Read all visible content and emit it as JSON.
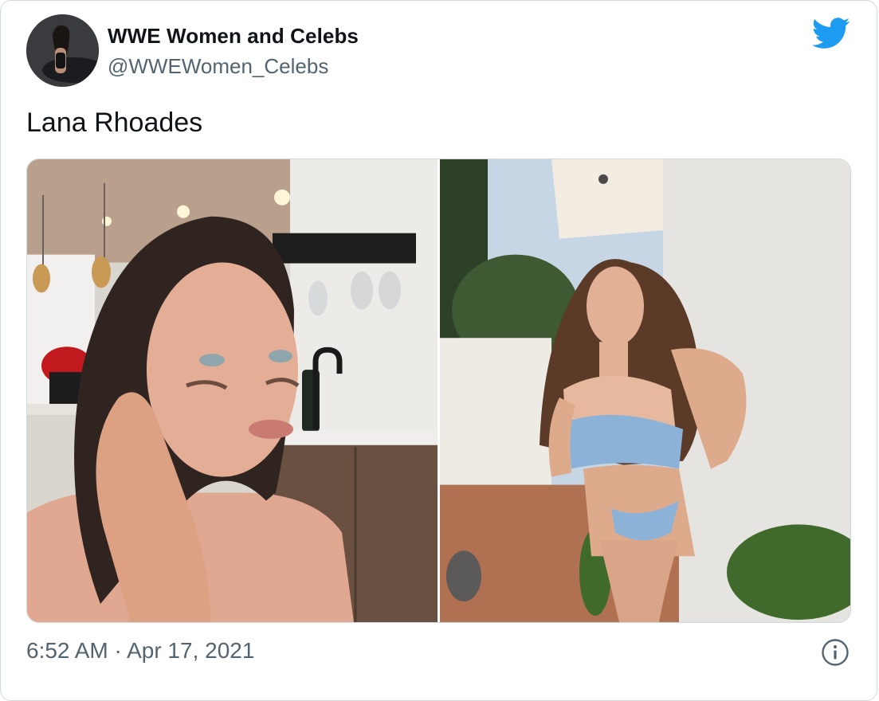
{
  "author": {
    "display_name": "WWE Women and Celebs",
    "handle": "@WWEWomen_Celebs",
    "avatar_icon": "profile-photo"
  },
  "tweet": {
    "text": "Lana Rhoades",
    "time": "6:52 AM",
    "separator": "·",
    "date": "Apr 17, 2021"
  },
  "media": {
    "count": 2,
    "photos": [
      {
        "icon": "photo-kitchen-selfie"
      },
      {
        "icon": "photo-patio-portrait"
      }
    ]
  },
  "icons": {
    "brand": "twitter-bird-icon",
    "info": "info-icon"
  },
  "colors": {
    "brand_blue": "#1d9bf0",
    "text_primary": "#0f1419",
    "text_secondary": "#536471",
    "border": "#cfd9de"
  }
}
